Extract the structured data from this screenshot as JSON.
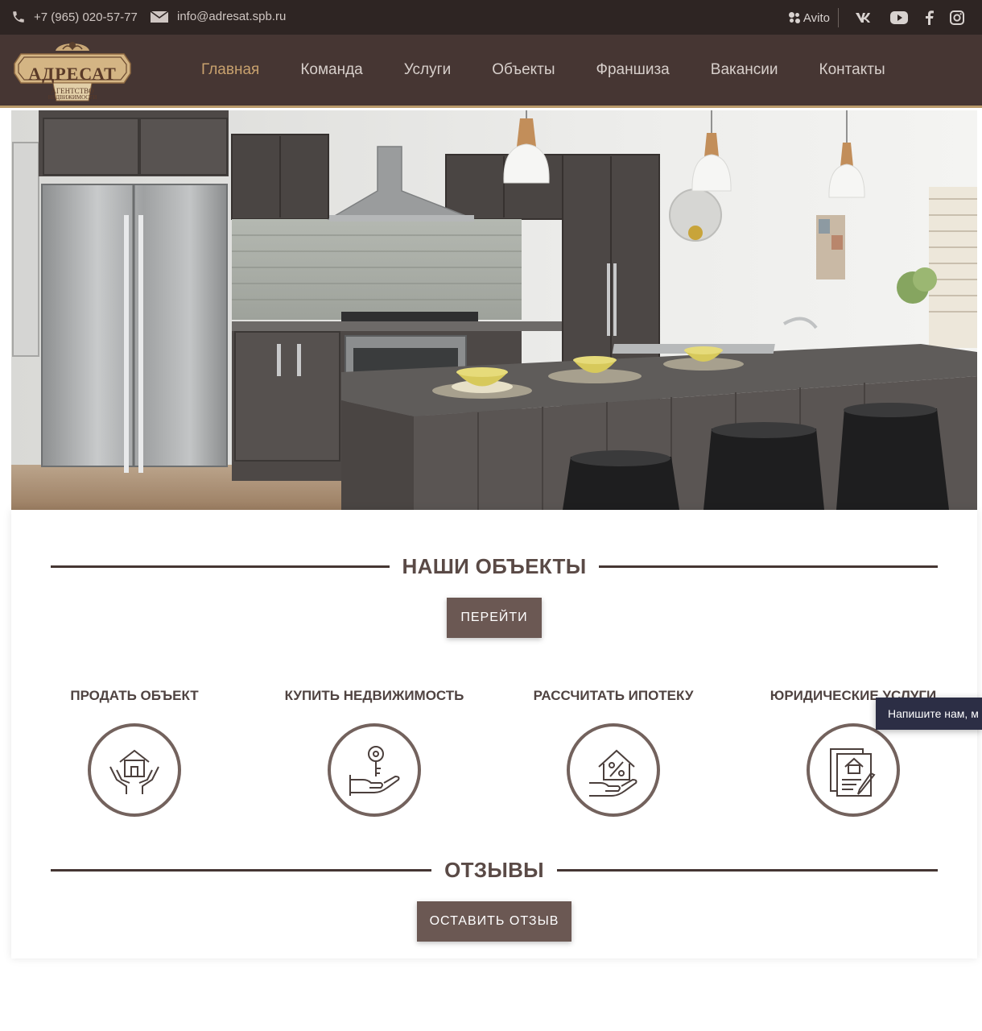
{
  "topbar": {
    "phone": "+7 (965) 020-57-77",
    "email": "info@adresat.spb.ru",
    "avito_label": "Avito",
    "socials": [
      "avito-icon",
      "vk-icon",
      "youtube-icon",
      "facebook-icon",
      "instagram-icon"
    ]
  },
  "logo": {
    "name": "АДРЕСАТ",
    "tagline_1": "АГЕНТСТВО",
    "tagline_2": "НЕДВИЖИМОСТИ"
  },
  "nav": {
    "items": [
      {
        "label": "Главная",
        "active": true
      },
      {
        "label": "Команда"
      },
      {
        "label": "Услуги"
      },
      {
        "label": "Объекты"
      },
      {
        "label": "Франшиза"
      },
      {
        "label": "Вакансии"
      },
      {
        "label": "Контакты"
      }
    ]
  },
  "objects_section": {
    "title": "НАШИ ОБЪЕКТЫ",
    "button": "ПЕРЕЙТИ"
  },
  "services": [
    {
      "title": "ПРОДАТЬ ОБЪЕКТ",
      "icon": "hands-house-icon"
    },
    {
      "title": "КУПИТЬ НЕДВИЖИМОСТЬ",
      "icon": "hand-key-icon"
    },
    {
      "title": "РАССЧИТАТЬ ИПОТЕКУ",
      "icon": "hand-house-percent-icon"
    },
    {
      "title": "ЮРИДИЧЕСКИЕ УСЛУГИ",
      "icon": "documents-house-icon"
    }
  ],
  "reviews_section": {
    "title": "ОТЗЫВЫ",
    "button": "ОСТАВИТЬ ОТЗЫВ"
  },
  "chat_widget": {
    "label": "Напишите нам, м"
  },
  "colors": {
    "topbar_bg": "#2e2523",
    "nav_bg": "#463633",
    "accent": "#c8a16e",
    "button_bg": "#6b5853",
    "chat_bg": "#2c2e45"
  }
}
